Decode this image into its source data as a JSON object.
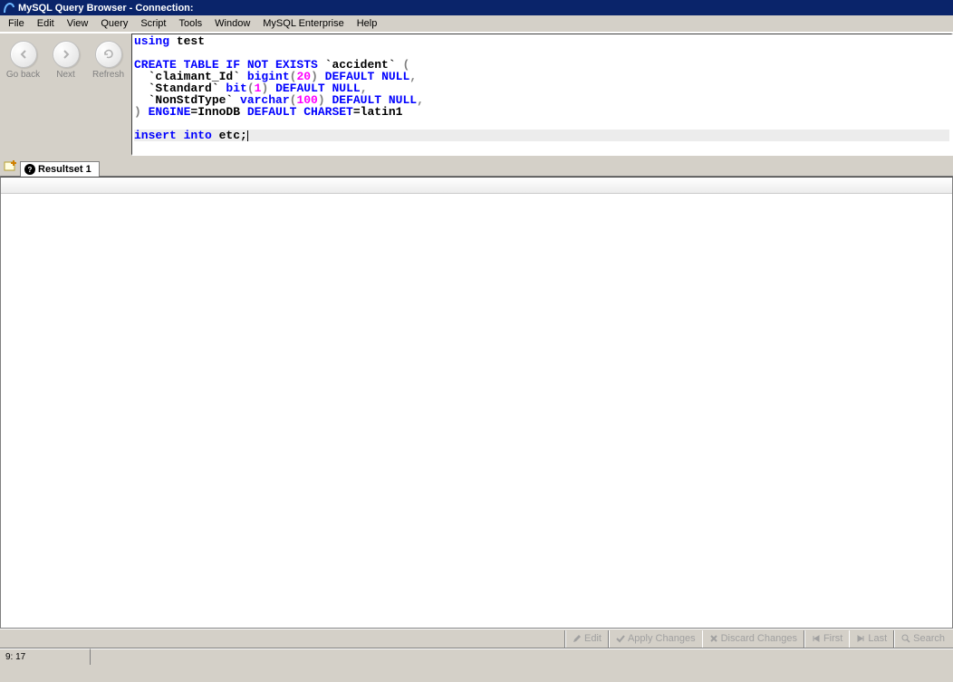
{
  "title": "MySQL Query Browser - Connection:",
  "menu": [
    "File",
    "Edit",
    "View",
    "Query",
    "Script",
    "Tools",
    "Window",
    "MySQL Enterprise",
    "Help"
  ],
  "nav": {
    "back": "Go back",
    "next": "Next",
    "refresh": "Refresh"
  },
  "sql": {
    "l1_kw": "using",
    "l1_txt": " test",
    "l3_kw": "CREATE TABLE IF NOT EXISTS",
    "l3_id": " `accident` ",
    "l3_p": "(",
    "l4_pre": "  `claimant_Id` ",
    "l4_kw1": "bigint",
    "l4_p1": "(",
    "l4_num": "20",
    "l4_p2": ") ",
    "l4_kw2": "DEFAULT NULL",
    "l4_c": ",",
    "l5_pre": "  `Standard` ",
    "l5_kw1": "bit",
    "l5_p1": "(",
    "l5_num": "1",
    "l5_p2": ") ",
    "l5_kw2": "DEFAULT NULL",
    "l5_c": ",",
    "l6_pre": "  `NonStdType` ",
    "l6_kw1": "varchar",
    "l6_p1": "(",
    "l6_num": "100",
    "l6_p2": ") ",
    "l6_kw2": "DEFAULT NULL",
    "l6_c": ",",
    "l7_p": ") ",
    "l7_kw1": "ENGINE",
    "l7_e": "=InnoDB ",
    "l7_kw2": "DEFAULT CHARSET",
    "l7_e2": "=latin1",
    "l9_kw": "insert into",
    "l9_txt": " etc;"
  },
  "tab": {
    "label": "Resultset 1"
  },
  "bottom": {
    "edit": "Edit",
    "apply": "Apply Changes",
    "discard": "Discard Changes",
    "first": "First",
    "last": "Last",
    "search": "Search"
  },
  "status": {
    "pos": "9: 17"
  }
}
